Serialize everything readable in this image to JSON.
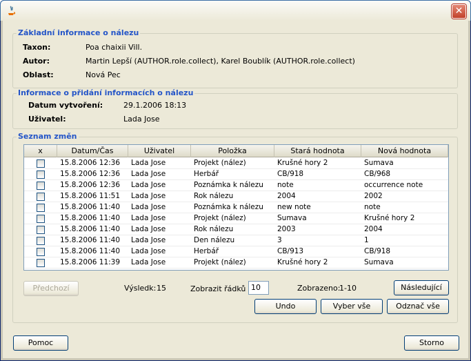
{
  "window": {
    "close_label": "✕"
  },
  "basic": {
    "title": "Základní informace o nálezu",
    "taxon_label": "Taxon:",
    "taxon_value": "Poa chaixii Vill.",
    "author_label": "Autor:",
    "author_value": "Martin Lepší (AUTHOR.role.collect), Karel Boublík (AUTHOR.role.collect)",
    "area_label": "Oblast:",
    "area_value": "Nová Pec"
  },
  "added": {
    "title": "Informace o přidání informacích o nálezu",
    "created_label": "Datum vytvoření:",
    "created_value": "29.1.2006 18:13",
    "user_label": "Uživatel:",
    "user_value": "Lada Jose"
  },
  "changes": {
    "title": "Seznam změn",
    "columns": [
      "x",
      "Datum/Čas",
      "Uživatel",
      "Položka",
      "Stará hodnota",
      "Nová hodnota"
    ],
    "rows": [
      {
        "date": "15.8.2006 12:36",
        "user": "Lada Jose",
        "item": "Projekt (nález)",
        "old": "Krušné hory 2",
        "new": "Sumava"
      },
      {
        "date": "15.8.2006 12:36",
        "user": "Lada Jose",
        "item": "Herbář",
        "old": "CB/918",
        "new": "CB/968"
      },
      {
        "date": "15.8.2006 12:36",
        "user": "Lada Jose",
        "item": "Poznámka k nálezu",
        "old": "note",
        "new": "occurrence note"
      },
      {
        "date": "15.8.2006 11:51",
        "user": "Lada Jose",
        "item": "Rok nálezu",
        "old": "2004",
        "new": "2002"
      },
      {
        "date": "15.8.2006 11:40",
        "user": "Lada Jose",
        "item": "Poznámka k nálezu",
        "old": "new note",
        "new": "note"
      },
      {
        "date": "15.8.2006 11:40",
        "user": "Lada Jose",
        "item": "Projekt (nález)",
        "old": "Sumava",
        "new": "Krušné hory 2"
      },
      {
        "date": "15.8.2006 11:40",
        "user": "Lada Jose",
        "item": "Rok nálezu",
        "old": "2003",
        "new": "2004"
      },
      {
        "date": "15.8.2006 11:40",
        "user": "Lada Jose",
        "item": "Den nálezu",
        "old": "3",
        "new": "1"
      },
      {
        "date": "15.8.2006 11:40",
        "user": "Lada Jose",
        "item": "Herbář",
        "old": "CB/913",
        "new": "CB/918"
      },
      {
        "date": "15.8.2006 11:39",
        "user": "Lada Jose",
        "item": "Projekt (nález)",
        "old": "Krušné hory 2",
        "new": "Sumava"
      }
    ],
    "prev_label": "Předchozí",
    "result_label": "Výsledk:",
    "result_value": "15",
    "rows_label": "Zobrazit řádků :",
    "rows_value": "10",
    "shown_label": "Zobrazeno:",
    "shown_value": "1-10",
    "next_label": "Následující",
    "undo_label": "Undo",
    "select_all_label": "Vyber vše",
    "deselect_all_label": "Odznač vše"
  },
  "footer": {
    "help_label": "Pomoc",
    "cancel_label": "Storno"
  }
}
